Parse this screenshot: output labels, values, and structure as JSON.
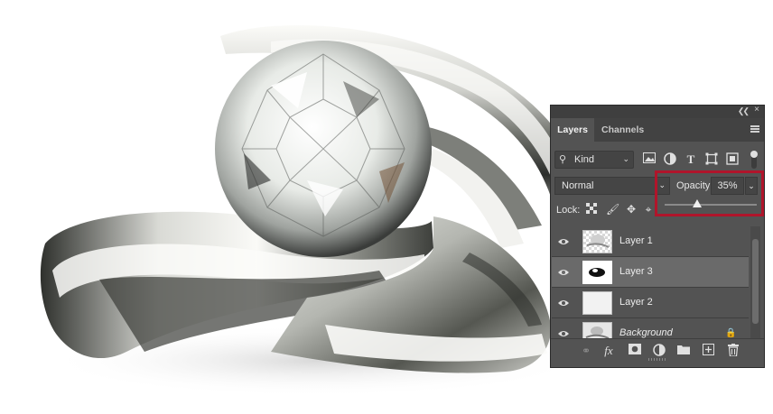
{
  "panel": {
    "tabs": [
      {
        "label": "Layers",
        "active": true
      },
      {
        "label": "Channels",
        "active": false
      }
    ],
    "collapse_icon": "double-chevron-left-icon",
    "close_icon": "close-icon",
    "menu_icon": "hamburger-menu-icon",
    "filter": {
      "label": "Kind",
      "icons": [
        "image-filter-icon",
        "adjustment-filter-icon",
        "type-filter-icon",
        "shape-filter-icon",
        "smart-object-filter-icon"
      ]
    },
    "blend_mode": "Normal",
    "opacity": {
      "label": "Opacity:",
      "value": "35%",
      "fraction": 0.35
    },
    "lock": {
      "label": "Lock:",
      "icons": [
        "lock-transparent-icon",
        "lock-pixels-icon",
        "lock-position-icon",
        "lock-artboard-icon"
      ]
    },
    "layers": [
      {
        "name": "Layer 1",
        "visible": true,
        "selected": false
      },
      {
        "name": "Layer 3",
        "visible": true,
        "selected": true
      },
      {
        "name": "Layer 2",
        "visible": true,
        "selected": false
      },
      {
        "name": "Background",
        "visible": true,
        "selected": false,
        "locked": true
      }
    ],
    "bottom_icons": [
      "link-layers-icon",
      "fx-icon",
      "add-mask-icon",
      "adjustment-layer-icon",
      "new-group-icon",
      "new-layer-icon",
      "trash-icon"
    ]
  },
  "colors": {
    "panel_bg": "#535353",
    "highlight_box": "#b0152b",
    "selected_row": "#6a6a6a"
  }
}
